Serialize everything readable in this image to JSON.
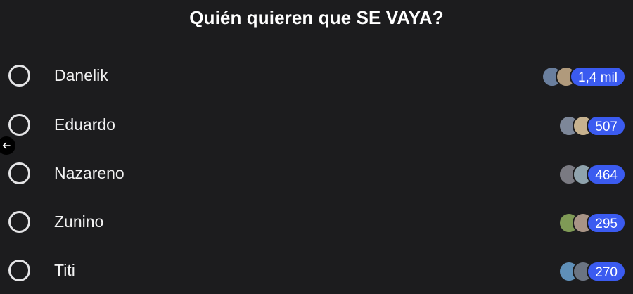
{
  "poll": {
    "question": "Quién quieren que SE VAYA?",
    "options": [
      {
        "label": "Danelik",
        "votes": "1,4 mil",
        "avatars": [
          "avatar-photo-icon",
          "avatar-photo-icon"
        ],
        "avatar_colors": [
          "#6a7f9e",
          "#b09a7c"
        ]
      },
      {
        "label": "Eduardo",
        "votes": "507",
        "avatars": [
          "avatar-photo-icon",
          "avatar-photo-icon"
        ],
        "avatar_colors": [
          "#7d8799",
          "#c7b28f"
        ]
      },
      {
        "label": "Nazareno",
        "votes": "464",
        "avatars": [
          "avatar-photo-icon",
          "avatar-photo-icon"
        ],
        "avatar_colors": [
          "#7a7a82",
          "#8fa3ad"
        ]
      },
      {
        "label": "Zunino",
        "votes": "295",
        "avatars": [
          "avatar-photo-icon",
          "avatar-photo-icon"
        ],
        "avatar_colors": [
          "#7f9a56",
          "#a89486"
        ]
      },
      {
        "label": "Titi",
        "votes": "270",
        "avatars": [
          "avatar-photo-icon",
          "avatar-photo-icon"
        ],
        "avatar_colors": [
          "#5f8fb8",
          "#6b7482"
        ]
      }
    ]
  },
  "colors": {
    "background": "#1c1c1e",
    "vote_badge": "#3b5bf0",
    "radio_border": "#e4e4e6"
  },
  "icons": {
    "back": "arrow-left-icon",
    "radio": "radio-unselected-icon"
  }
}
